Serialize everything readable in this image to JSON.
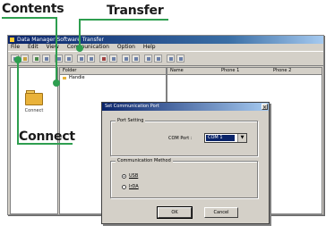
{
  "callouts": {
    "contents": "Contents",
    "transfer": "Transfer",
    "connect": "Connect"
  },
  "accent_color": "#2e9e4f",
  "app": {
    "title": "Data Manager Software Transfer",
    "menu": [
      "File",
      "Edit",
      "View",
      "Communication",
      "Option",
      "Help"
    ],
    "toolbar_icons": [
      "connect-icon",
      "contents-icon",
      "transfer-icon",
      "open-icon",
      "save-icon",
      "cut-icon",
      "copy-icon",
      "paste-icon",
      "delete-icon",
      "view-icon",
      "list-icon",
      "details-icon",
      "zoom-icon",
      "print-icon",
      "settings-icon",
      "help-icon"
    ],
    "left_pane": {
      "connect_label": "Connect"
    },
    "file_pane": {
      "header": "Folder",
      "items": [
        "Handie"
      ]
    },
    "list_pane": {
      "headers": [
        "Name",
        "Phone 1",
        "Phone 2"
      ]
    }
  },
  "dialog": {
    "title": "Set Communication Port",
    "close_glyph": "×",
    "port_group": {
      "title": "Port Setting",
      "com_label": "COM Port :",
      "com_value": "COM 1",
      "dropdown_glyph": "▼"
    },
    "method_group": {
      "title": "Communication Method",
      "options": [
        "USB",
        "IrDA"
      ],
      "selected": "USB"
    },
    "ok_label": "OK",
    "cancel_label": "Cancel"
  }
}
